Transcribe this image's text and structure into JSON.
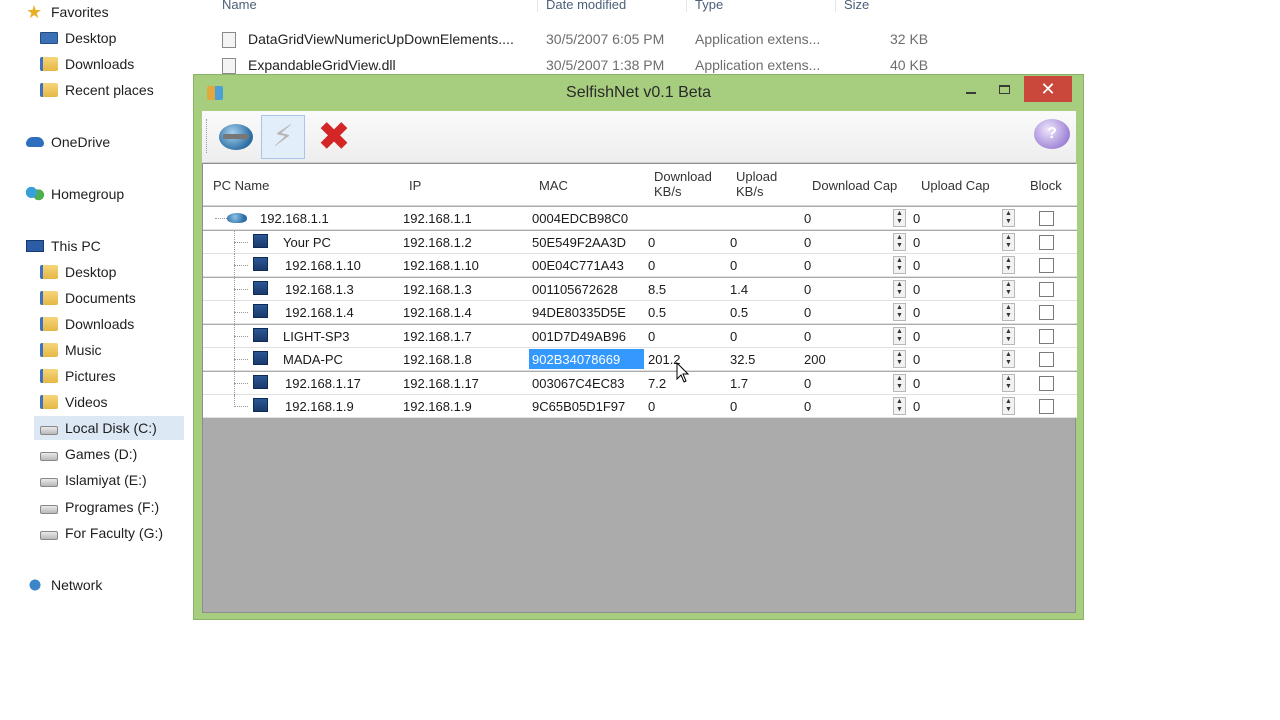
{
  "nav": {
    "favorites": "Favorites",
    "desktop": "Desktop",
    "downloads": "Downloads",
    "recent": "Recent places",
    "onedrive": "OneDrive",
    "homegroup": "Homegroup",
    "thispc": "This PC",
    "pc_desktop": "Desktop",
    "pc_documents": "Documents",
    "pc_downloads": "Downloads",
    "pc_music": "Music",
    "pc_pictures": "Pictures",
    "pc_videos": "Videos",
    "local_disk": "Local Disk (C:)",
    "games": "Games (D:)",
    "islamiyat": "Islamiyat (E:)",
    "programes": "Programes  (F:)",
    "faculty": "For Faculty (G:)",
    "network": "Network"
  },
  "files": {
    "headers": {
      "name": "Name",
      "date": "Date modified",
      "type": "Type",
      "size": "Size"
    },
    "rows": [
      {
        "name": "DataGridViewNumericUpDownElements....",
        "date": "30/5/2007 6:05 PM",
        "type": "Application extens...",
        "size": "32 KB"
      },
      {
        "name": "ExpandableGridView.dll",
        "date": "30/5/2007 1:38 PM",
        "type": "Application extens...",
        "size": "40 KB"
      }
    ]
  },
  "window": {
    "title": "SelfishNet v0.1 Beta",
    "close_glyph": "✕",
    "help_glyph": "?",
    "bolt_glyph": "⚡",
    "x_glyph": "✖"
  },
  "grid": {
    "headers": {
      "pcname": "PC Name",
      "ip": "IP",
      "mac": "MAC",
      "download_1": "Download",
      "download_2": "KB/s",
      "upload_1": "Upload",
      "upload_2": "KB/s",
      "download_cap": "Download Cap",
      "upload_cap": "Upload Cap",
      "block": "Block"
    },
    "rows": [
      {
        "name": "192.168.1.1",
        "ip": "192.168.1.1",
        "mac": "0004EDCB98C0",
        "down": "",
        "up": "",
        "dcap": "0",
        "ucap": "0",
        "blocked": false
      },
      {
        "name": "Your PC",
        "ip": "192.168.1.2",
        "mac": "50E549F2AA3D",
        "down": "0",
        "up": "0",
        "dcap": "0",
        "ucap": "0",
        "blocked": false
      },
      {
        "name": "192.168.1.10",
        "ip": "192.168.1.10",
        "mac": "00E04C771A43",
        "down": "0",
        "up": "0",
        "dcap": "0",
        "ucap": "0",
        "blocked": false
      },
      {
        "name": "192.168.1.3",
        "ip": "192.168.1.3",
        "mac": "001105672628",
        "down": "8.5",
        "up": "1.4",
        "dcap": "0",
        "ucap": "0",
        "blocked": false
      },
      {
        "name": "192.168.1.4",
        "ip": "192.168.1.4",
        "mac": "94DE80335D5E",
        "down": "0.5",
        "up": "0.5",
        "dcap": "0",
        "ucap": "0",
        "blocked": false
      },
      {
        "name": "LIGHT-SP3",
        "ip": "192.168.1.7",
        "mac": "001D7D49AB96",
        "down": "0",
        "up": "0",
        "dcap": "0",
        "ucap": "0",
        "blocked": false
      },
      {
        "name": "MADA-PC",
        "ip": "192.168.1.8",
        "mac": "902B34078669",
        "down": "201.2",
        "up": "32.5",
        "dcap": "200",
        "ucap": "0",
        "blocked": false
      },
      {
        "name": "192.168.1.17",
        "ip": "192.168.1.17",
        "mac": "003067C4EC83",
        "down": "7.2",
        "up": "1.7",
        "dcap": "0",
        "ucap": "0",
        "blocked": false
      },
      {
        "name": "192.168.1.9",
        "ip": "192.168.1.9",
        "mac": "9C65B05D1F97",
        "down": "0",
        "up": "0",
        "dcap": "0",
        "ucap": "0",
        "blocked": false
      }
    ]
  }
}
